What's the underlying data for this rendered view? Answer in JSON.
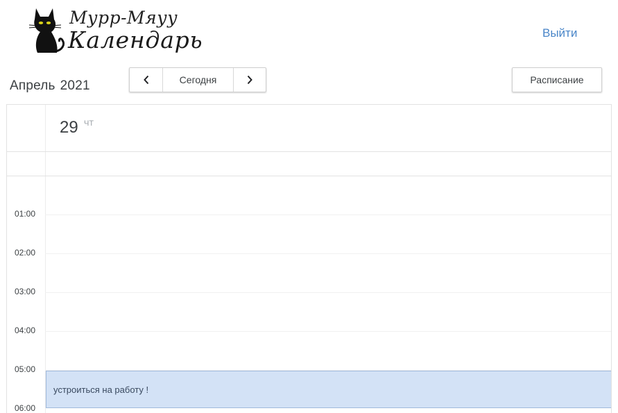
{
  "app": {
    "logo_line1": "Мурр-Мяуу",
    "logo_line2": "Календарь",
    "logo_icon": "black-cat-icon",
    "logout_label": "Выйти",
    "accent_color": "#4a86c8"
  },
  "toolbar": {
    "month": "Апрель",
    "year": "2021",
    "prev_icon": "chevron-left-icon",
    "today_label": "Сегодня",
    "next_icon": "chevron-right-icon",
    "schedule_label": "Расписание"
  },
  "day": {
    "number": "29",
    "weekday": "ЧТ"
  },
  "hours": [
    "01:00",
    "02:00",
    "03:00",
    "04:00",
    "05:00",
    "06:00"
  ],
  "events": [
    {
      "title": "устроиться на работу !",
      "color": "#d3e2f6"
    }
  ]
}
